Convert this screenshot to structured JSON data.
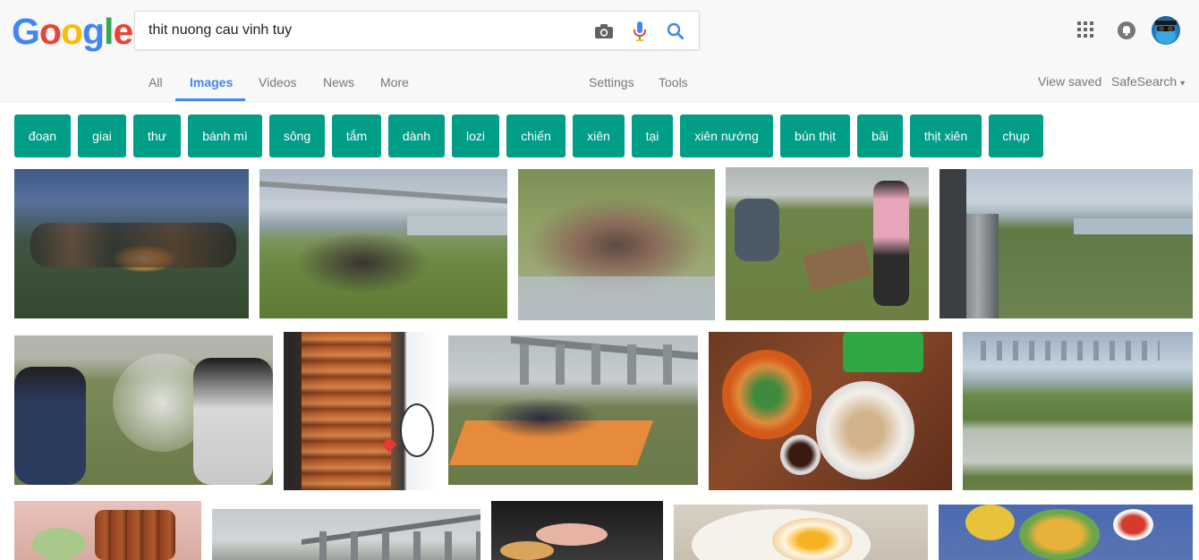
{
  "logo": {
    "letters": [
      "G",
      "o",
      "o",
      "g",
      "l",
      "e"
    ],
    "colors": [
      "#4285f4",
      "#ea4335",
      "#fbbc05",
      "#4285f4",
      "#34a853",
      "#ea4335"
    ]
  },
  "search": {
    "value": "thit nuong cau vinh tuy",
    "icons": [
      "camera-icon",
      "microphone-icon",
      "search-icon"
    ]
  },
  "tabs": [
    "All",
    "Images",
    "Videos",
    "News",
    "More"
  ],
  "active_tab": "Images",
  "tools": {
    "settings": "Settings",
    "tools": "Tools",
    "view_saved": "View saved",
    "safesearch": "SafeSearch",
    "safesearch_caret": "▾"
  },
  "account_icons": [
    "apps-icon",
    "notifications-icon",
    "avatar"
  ],
  "chips": [
    "đoạn",
    "giai",
    "thư",
    "bánh mì",
    "sông",
    "tắm",
    "dành",
    "lozi",
    "chiến",
    "xiên",
    "tại",
    "xiên nướng",
    "bún thịt",
    "bãi",
    "thịt xiên",
    "chụp"
  ],
  "chip_color": "#009e86",
  "accent_color": "#4285f4",
  "images": [
    {
      "subject": "picnic-dusk-campfire"
    },
    {
      "subject": "bridge-river-picnic"
    },
    {
      "subject": "picnic-girls-grass"
    },
    {
      "subject": "grilling-on-grass"
    },
    {
      "subject": "bridge-railing-riverbank"
    },
    {
      "subject": "grilling-smoke-closeup"
    },
    {
      "subject": "skewers-grill-sticker"
    },
    {
      "subject": "bridge-picnic-mat"
    },
    {
      "subject": "bun-thit-nuong-bowls"
    },
    {
      "subject": "river-landscape"
    },
    {
      "subject": "skewers-plate"
    },
    {
      "subject": "bridge-landscape"
    },
    {
      "subject": "food-stall-night"
    },
    {
      "subject": "fried-egg-plate"
    },
    {
      "subject": "fries-table-spread"
    }
  ]
}
